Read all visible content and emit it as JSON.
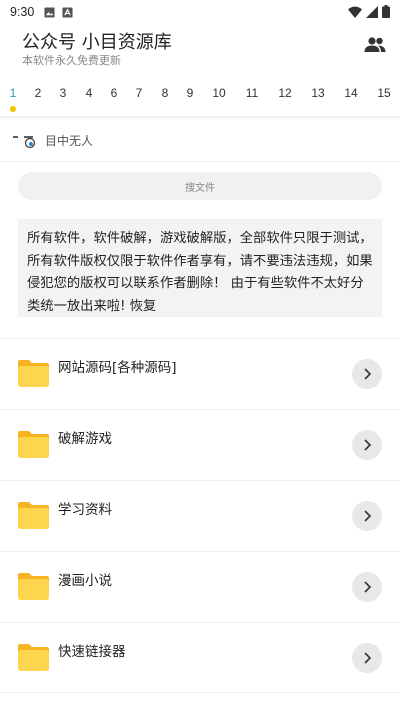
{
  "status_bar": {
    "time": "9:30",
    "icons": [
      "image-icon",
      "text-icon",
      "wifi-icon",
      "signal-icon",
      "battery-icon"
    ]
  },
  "header": {
    "title": "公众号 小目资源库",
    "subtitle": "本软件永久免费更新",
    "action_icon": "people-icon"
  },
  "tabs": {
    "active_index": 0,
    "items": [
      "1",
      "2",
      "3",
      "4",
      "6",
      "7",
      "8",
      "9",
      "10",
      "11",
      "12",
      "13",
      "14",
      "15"
    ]
  },
  "user": {
    "name": "目中无人",
    "avatar_icon": "emoji-face-icon"
  },
  "search": {
    "placeholder": "搜文件"
  },
  "notice": {
    "text": "所有软件，软件破解，游戏破解版，全部软件只限于测试，所有软件版权仅限于软件作者享有，请不要违法违规，如果侵犯您的版权可以联系作者删除！ 由于有些软件不太好分类统一放出来啦! 恢复"
  },
  "folders": [
    {
      "name": "网站源码[各种源码]"
    },
    {
      "name": "破解游戏"
    },
    {
      "name": "学习资料"
    },
    {
      "name": "漫画小说"
    },
    {
      "name": "快速链接器"
    }
  ],
  "colors": {
    "accent": "#1aa3b6",
    "active_dot": "#f5c400",
    "folder": "#fdd54e",
    "folder_back": "#f6b322"
  }
}
